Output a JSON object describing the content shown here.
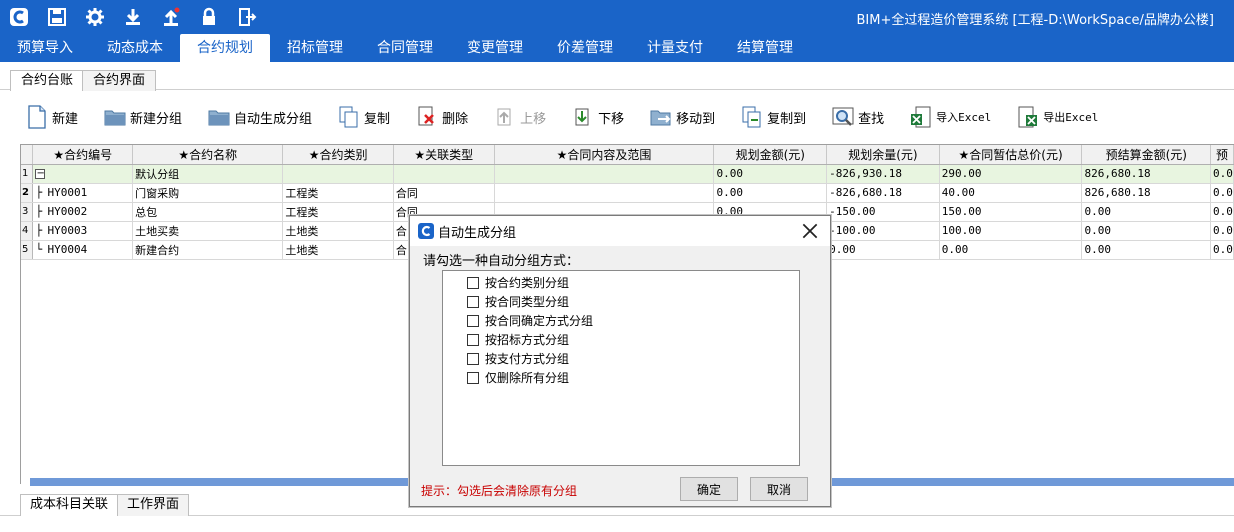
{
  "app": {
    "title": "BIM+全过程造价管理系统 [工程-D:\\WorkSpace/品牌办公楼]"
  },
  "quick_access": [
    "app-logo-icon",
    "save-icon",
    "gear-icon",
    "download-icon",
    "upload-icon",
    "lock-icon",
    "exit-icon"
  ],
  "menu_tabs": [
    "预算导入",
    "动态成本",
    "合约规划",
    "招标管理",
    "合同管理",
    "变更管理",
    "价差管理",
    "计量支付",
    "结算管理"
  ],
  "sub_tabs": [
    "合约台账",
    "合约界面"
  ],
  "toolbar": {
    "new": "新建",
    "new_group": "新建分组",
    "auto_group": "自动生成分组",
    "copy": "复制",
    "delete": "删除",
    "move_up": "上移",
    "move_down": "下移",
    "move_to": "移动到",
    "copy_to": "复制到",
    "find": "查找",
    "import_excel": "导入Excel",
    "export_excel": "导出Excel"
  },
  "grid": {
    "columns": [
      "★合约编号",
      "★合约名称",
      "★合约类别",
      "★关联类型",
      "★合同内容及范围",
      "规划金额(元)",
      "规划余量(元)",
      "★合同暂估总价(元)",
      "预结算金额(元)",
      "预"
    ],
    "group": {
      "row_no": "1",
      "expander": "−",
      "name": "默认分组",
      "amount": "0.00",
      "remain": "-826,930.18",
      "estimate": "290.00",
      "settle": "826,680.18",
      "extra": "0.0"
    },
    "rows": [
      {
        "row_no": "2",
        "code": "HY0001",
        "name": "门窗采购",
        "category": "工程类",
        "relation": "合同",
        "scope": "",
        "amount": "0.00",
        "remain": "-826,680.18",
        "estimate": "40.00",
        "settle": "826,680.18",
        "extra": "0.0"
      },
      {
        "row_no": "3",
        "code": "HY0002",
        "name": "总包",
        "category": "工程类",
        "relation": "合同",
        "scope": "",
        "amount": "0.00",
        "remain": "-150.00",
        "estimate": "150.00",
        "settle": "0.00",
        "extra": "0.0"
      },
      {
        "row_no": "4",
        "code": "HY0003",
        "name": "土地买卖",
        "category": "土地类",
        "relation": "合",
        "scope": "",
        "amount": "",
        "remain": "-100.00",
        "estimate": "100.00",
        "settle": "0.00",
        "extra": "0.0"
      },
      {
        "row_no": "5",
        "code": "HY0004",
        "name": "新建合约",
        "category": "土地类",
        "relation": "合",
        "scope": "",
        "amount": "",
        "remain": "0.00",
        "estimate": "0.00",
        "settle": "0.00",
        "extra": "0.0"
      }
    ]
  },
  "bottom_tabs": [
    "成本科目关联",
    "工作界面"
  ],
  "dialog": {
    "title": "自动生成分组",
    "prompt": "请勾选一种自动分组方式：",
    "options": [
      "按合约类别分组",
      "按合同类型分组",
      "按合同确定方式分组",
      "按招标方式分组",
      "按支付方式分组",
      "仅删除所有分组"
    ],
    "hint": "提示：勾选后会清除原有分组",
    "ok": "确定",
    "cancel": "取消"
  },
  "colors": {
    "title_bar": "#1a64c8",
    "group_row": "#e8f5e0",
    "hint_text": "#c80000",
    "scrollbar": "#6f99d8"
  }
}
